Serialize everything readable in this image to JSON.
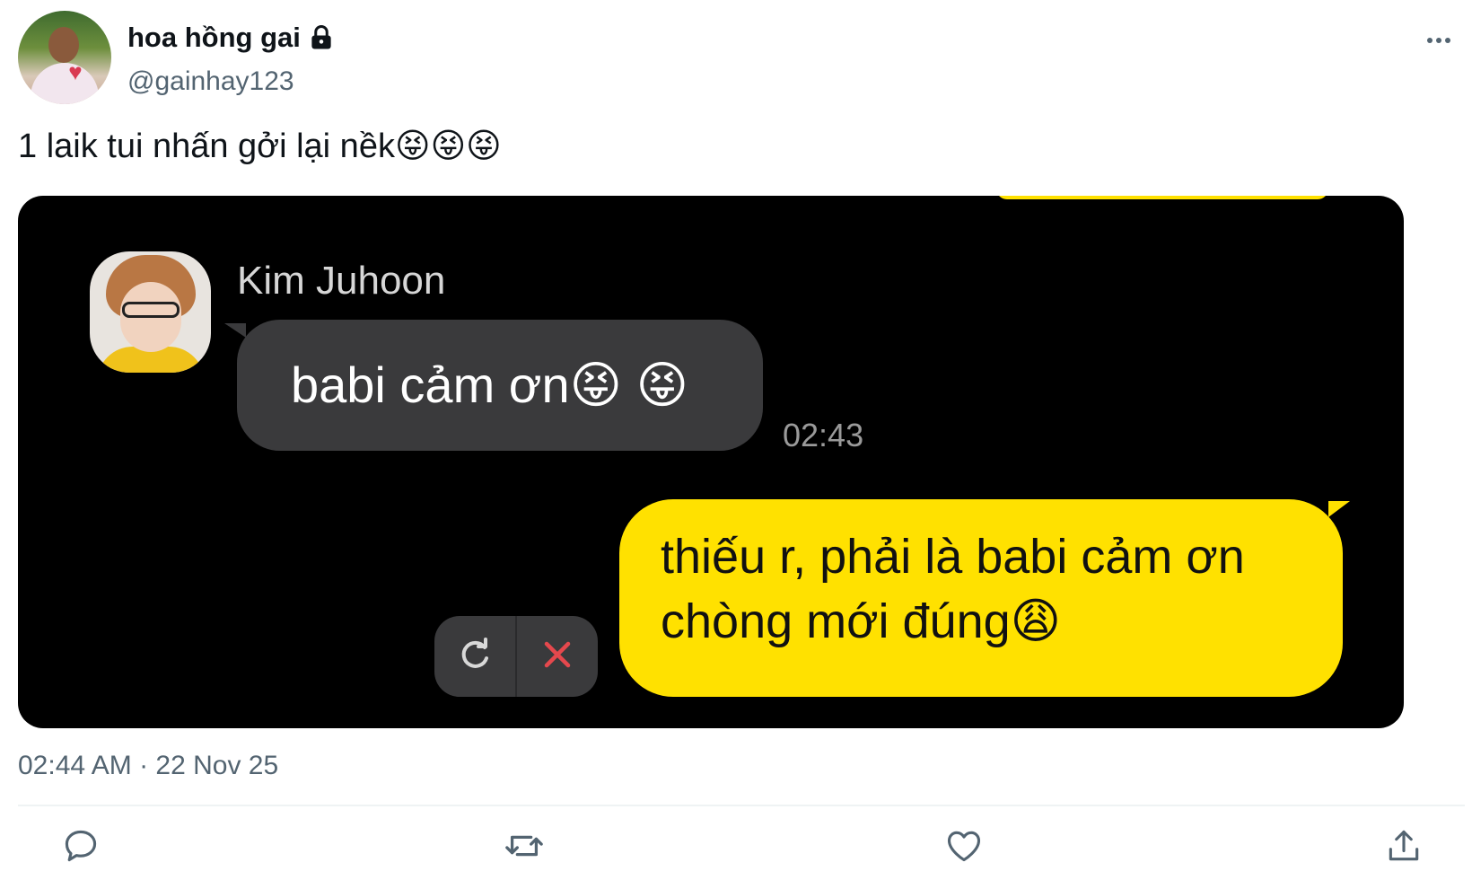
{
  "author": {
    "display_name": "hoa hồng gai",
    "handle": "@gainhay123"
  },
  "tweet": {
    "text": "1 laik tui nhấn gởi lại nềk😝😝😝",
    "timestamp": "02:44 AM · 22 Nov 25"
  },
  "chat": {
    "sender_name": "Kim Juhoon",
    "received_message": "babi cảm ơn😝 😝",
    "received_time": "02:43",
    "sent_message": "thiếu r, phải là babi cảm ơn chòng mới đúng😩"
  },
  "icons": {
    "more": "more-horizontal-icon",
    "reply": "reply-icon",
    "retweet": "retweet-icon",
    "like": "heart-icon",
    "share": "share-icon",
    "lock": "lock-icon",
    "resend": "resend-icon",
    "cancel": "close-icon"
  },
  "colors": {
    "accent_yellow": "#ffe100",
    "bubble_gray": "#3a3a3c",
    "secondary_text": "#536471",
    "cancel_red": "#e5484d"
  }
}
